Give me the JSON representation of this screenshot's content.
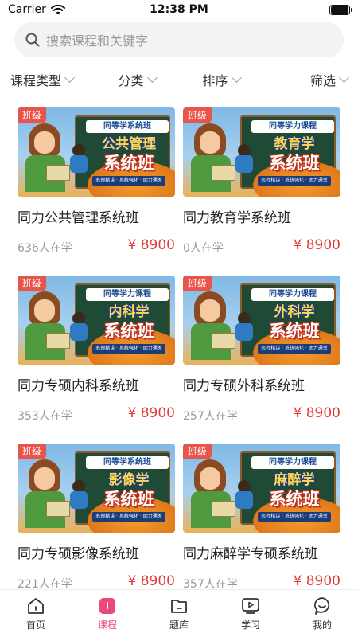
{
  "status": {
    "carrier": "Carrier",
    "time": "12:38 PM"
  },
  "search": {
    "placeholder": "搜索课程和关键字"
  },
  "filters": [
    {
      "label": "课程类型"
    },
    {
      "label": "分类"
    },
    {
      "label": "排序"
    },
    {
      "label": "筛选"
    }
  ],
  "courses": [
    {
      "badge": "班级",
      "banner": "同等学系统班",
      "subject": "公共管理",
      "system": "系统班",
      "slogan": "名师精讲 · 系统强化 · 助力通关",
      "title": "同力公共管理系统班",
      "learners": "636人在学",
      "price": "¥ 8900"
    },
    {
      "badge": "班级",
      "banner": "同等学力课程",
      "subject": "教育学",
      "system": "系统班",
      "slogan": "名师精讲 · 系统强化 · 助力通关",
      "title": "同力教育学系统班",
      "learners": "0人在学",
      "price": "¥ 8900"
    },
    {
      "badge": "班级",
      "banner": "同等学力课程",
      "subject": "内科学",
      "system": "系统班",
      "slogan": "名师精讲 · 系统强化 · 助力通关",
      "title": "同力专硕内科系统班",
      "learners": "353人在学",
      "price": "¥ 8900"
    },
    {
      "badge": "班级",
      "banner": "同等学力课程",
      "subject": "外科学",
      "system": "系统班",
      "slogan": "名师精讲 · 系统强化 · 助力通关",
      "title": "同力专硕外科系统班",
      "learners": "257人在学",
      "price": "¥ 8900"
    },
    {
      "badge": "班级",
      "banner": "同等学系统班",
      "subject": "影像学",
      "system": "系统班",
      "slogan": "名师精讲 · 系统强化 · 助力通关",
      "title": "同力专硕影像系统班",
      "learners": "221人在学",
      "price": "¥ 8900"
    },
    {
      "badge": "班级",
      "banner": "同等学力课程",
      "subject": "麻醉学",
      "system": "系统班",
      "slogan": "名师精讲 · 系统强化 · 助力通关",
      "title": "同力麻醉学专硕系统班",
      "learners": "357人在学",
      "price": "¥ 8900"
    }
  ],
  "tabs": [
    {
      "label": "首页",
      "icon": "home-icon"
    },
    {
      "label": "课程",
      "icon": "course-icon",
      "active": true
    },
    {
      "label": "题库",
      "icon": "question-bank-icon"
    },
    {
      "label": "学习",
      "icon": "study-icon"
    },
    {
      "label": "我的",
      "icon": "profile-icon"
    }
  ],
  "colors": {
    "accent": "#e94a7a",
    "price": "#e23d32",
    "badge": "#e9544b"
  }
}
